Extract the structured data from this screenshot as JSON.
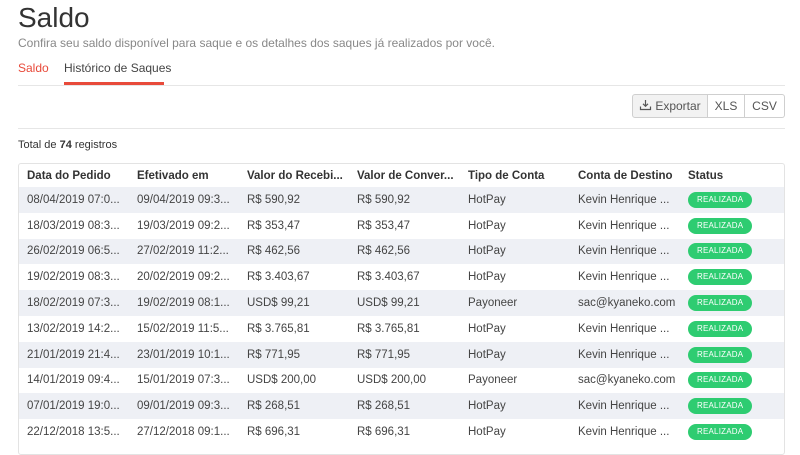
{
  "header": {
    "title": "Saldo",
    "subtitle": "Confira seu saldo disponível para saque e os detalhes dos saques já realizados por você."
  },
  "tabs": [
    {
      "label": "Saldo",
      "active": false
    },
    {
      "label": "Histórico de Saques",
      "active": true
    }
  ],
  "toolbar": {
    "export_label": "Exportar",
    "export_icon": "download-tray-icon",
    "xls_label": "XLS",
    "csv_label": "CSV"
  },
  "total": {
    "prefix": "Total de",
    "count": "74",
    "suffix": "registros"
  },
  "table": {
    "columns": [
      "Data do Pedido",
      "Efetivado em",
      "Valor do Recebi...",
      "Valor de Conver...",
      "Tipo de Conta",
      "Conta de Destino",
      "Status"
    ],
    "rows": [
      [
        "08/04/2019 07:0...",
        "09/04/2019 09:3...",
        "R$ 590,92",
        "R$ 590,92",
        "HotPay",
        "Kevin Henrique ...",
        "REALIZADA"
      ],
      [
        "18/03/2019 08:3...",
        "19/03/2019 09:2...",
        "R$ 353,47",
        "R$ 353,47",
        "HotPay",
        "Kevin Henrique ...",
        "REALIZADA"
      ],
      [
        "26/02/2019 06:5...",
        "27/02/2019 11:2...",
        "R$ 462,56",
        "R$ 462,56",
        "HotPay",
        "Kevin Henrique ...",
        "REALIZADA"
      ],
      [
        "19/02/2019 08:3...",
        "20/02/2019 09:2...",
        "R$ 3.403,67",
        "R$ 3.403,67",
        "HotPay",
        "Kevin Henrique ...",
        "REALIZADA"
      ],
      [
        "18/02/2019 07:3...",
        "19/02/2019 08:1...",
        "USD$ 99,21",
        "USD$ 99,21",
        "Payoneer",
        "sac@kyaneko.com",
        "REALIZADA"
      ],
      [
        "13/02/2019 14:2...",
        "15/02/2019 11:5...",
        "R$ 3.765,81",
        "R$ 3.765,81",
        "HotPay",
        "Kevin Henrique ...",
        "REALIZADA"
      ],
      [
        "21/01/2019 21:4...",
        "23/01/2019 10:1...",
        "R$ 771,95",
        "R$ 771,95",
        "HotPay",
        "Kevin Henrique ...",
        "REALIZADA"
      ],
      [
        "14/01/2019 09:4...",
        "15/01/2019 07:3...",
        "USD$ 200,00",
        "USD$ 200,00",
        "Payoneer",
        "sac@kyaneko.com",
        "REALIZADA"
      ],
      [
        "07/01/2019 19:0...",
        "09/01/2019 09:3...",
        "R$ 268,51",
        "R$ 268,51",
        "HotPay",
        "Kevin Henrique ...",
        "REALIZADA"
      ],
      [
        "22/12/2018 13:5...",
        "27/12/2018 09:1...",
        "R$ 696,31",
        "R$ 696,31",
        "HotPay",
        "Kevin Henrique ...",
        "REALIZADA"
      ]
    ]
  },
  "colors": {
    "accent": "#e84a3a",
    "status_success": "#2ecc71",
    "row_stripe": "#eef0f5"
  }
}
